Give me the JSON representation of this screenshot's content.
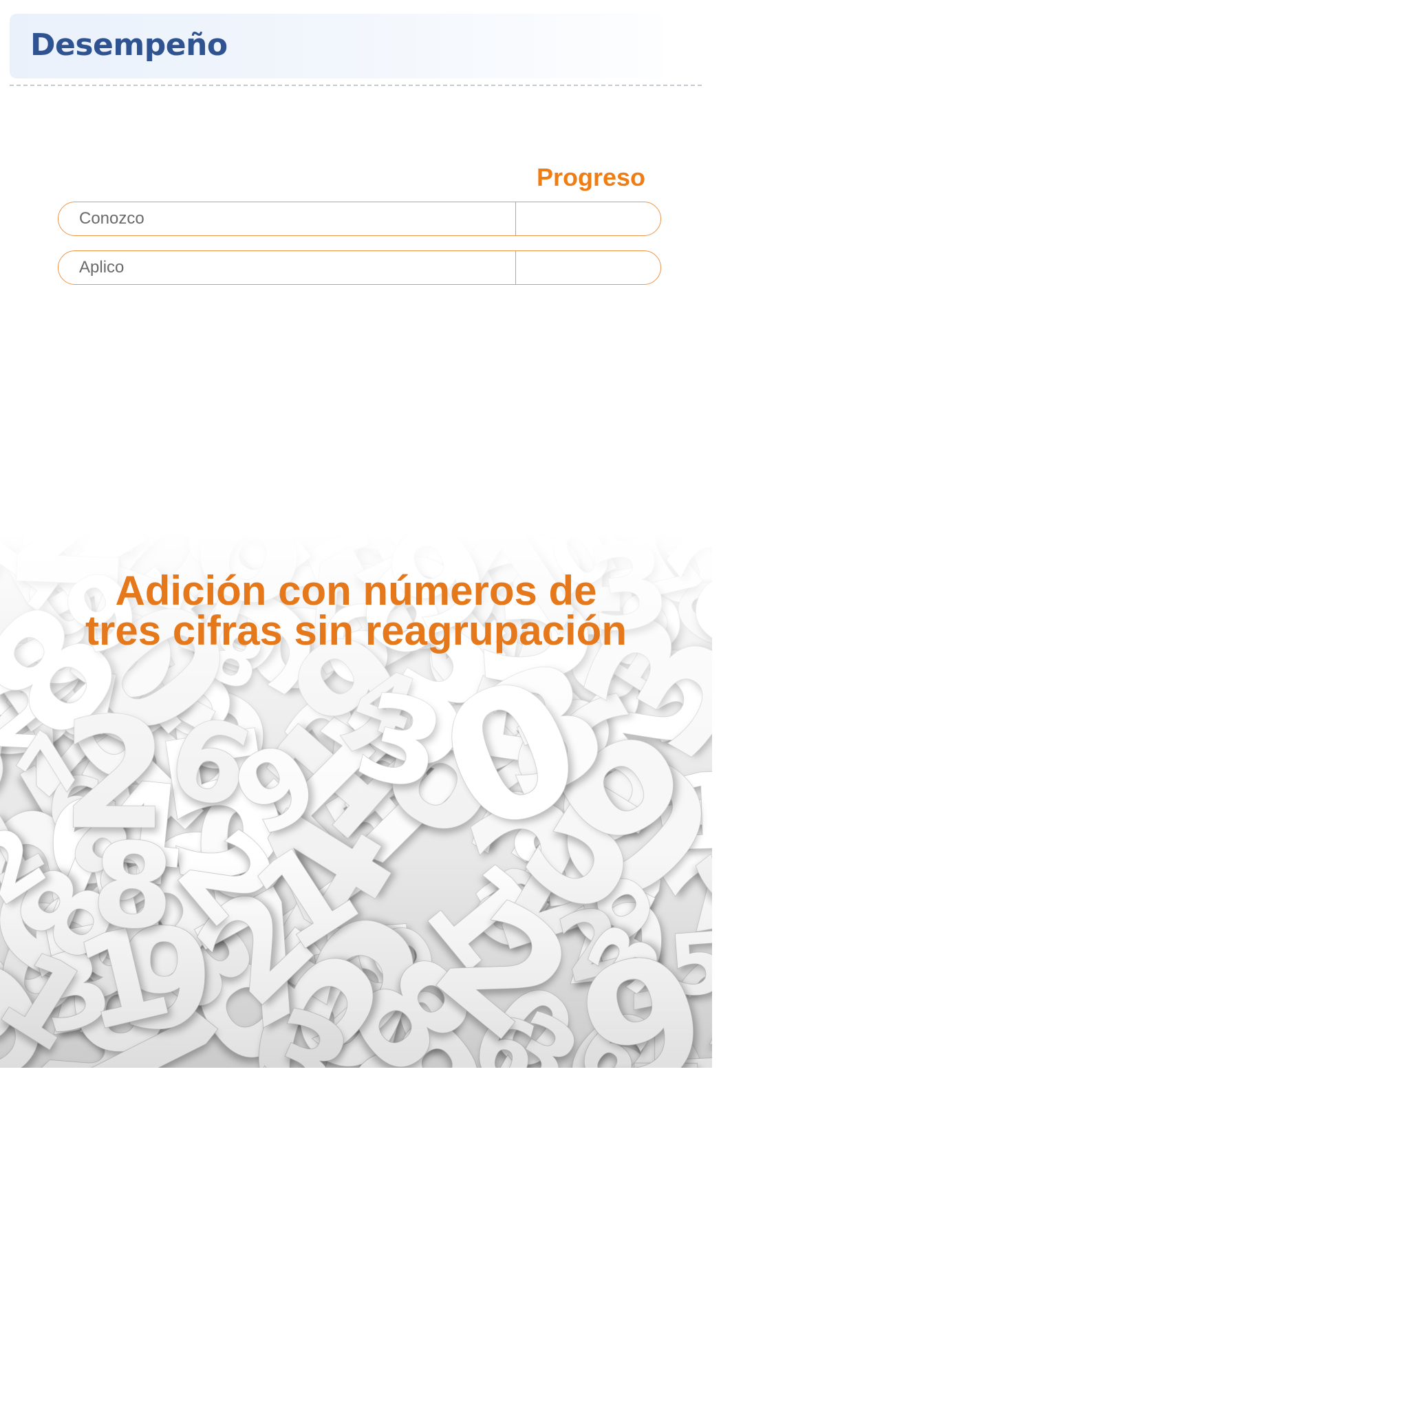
{
  "header": {
    "title": "Desempeño"
  },
  "progress": {
    "heading": "Progreso",
    "rows": [
      {
        "label": "Conozco",
        "value": ""
      },
      {
        "label": "Aplico",
        "value": ""
      }
    ]
  },
  "banner": {
    "title_line1": "Adición con números de",
    "title_line2": "tres cifras sin reagrupación"
  },
  "colors": {
    "header_title": "#2f5291",
    "accent_orange": "#ef7d16",
    "row_border": "#ee9547",
    "row_label": "#6a6a6a",
    "banner_title": "#e5781b"
  },
  "icons": [
    "scattered-numbers-background"
  ]
}
